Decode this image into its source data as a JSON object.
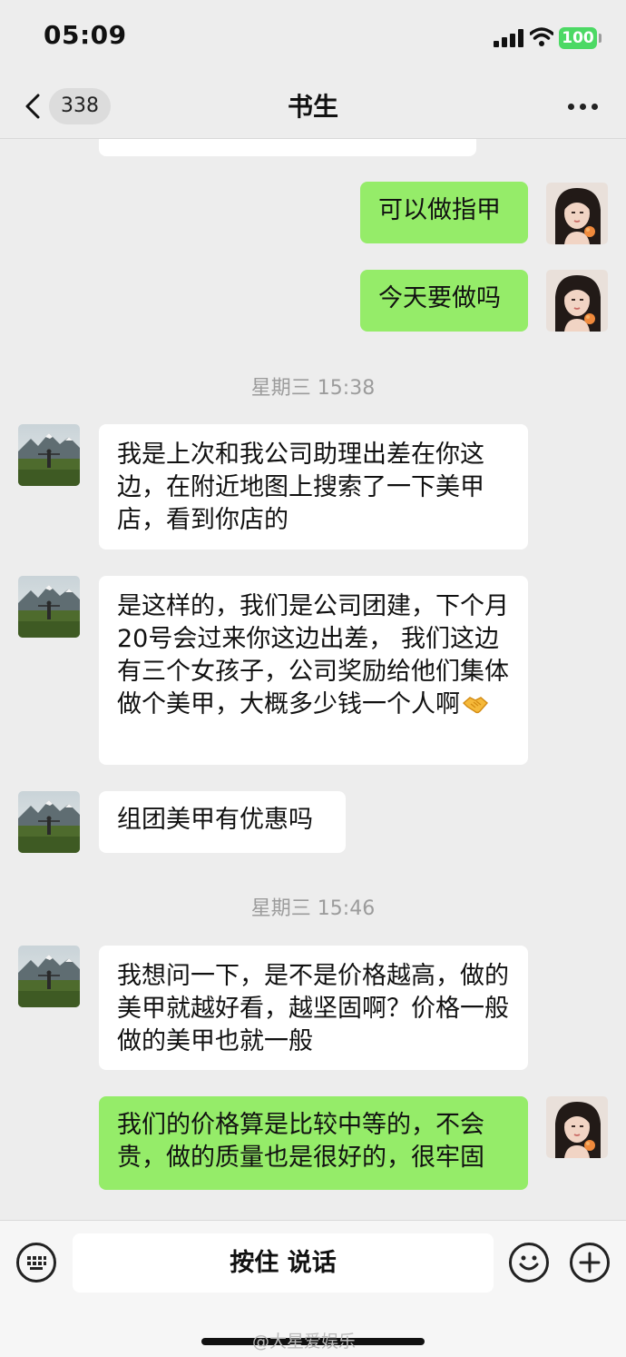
{
  "status_bar": {
    "time": "05:09",
    "battery": "100"
  },
  "nav": {
    "unread_count": "338",
    "title": "书生"
  },
  "messages": [
    {
      "text": "可以做指甲"
    },
    {
      "text": "今天要做吗"
    },
    {
      "time": "星期三 15:38"
    },
    {
      "text": " 我是上次和我公司助理出差在你这边，在附近地图上搜索了一下美甲店，看到你店的"
    },
    {
      "text": "是这样的，我们是公司团建，下个月20号会过来你这边出差， 我们这边有三个女孩子，公司奖励给他们集体做个美甲，大概多少钱一个人啊"
    },
    {
      "text": "组团美甲有优惠吗"
    },
    {
      "time": "星期三 15:46"
    },
    {
      "text": "我想问一下，是不是价格越高，做的美甲就越好看，越坚固啊？价格一般做的美甲也就一般"
    },
    {
      "text": "我们的价格算是比较中等的，不会贵，做的质量也是很好的，很牢固"
    }
  ],
  "input_bar": {
    "voice_label": "按住 说话"
  },
  "watermark": "@大星爱娱乐",
  "colors": {
    "outgoing_bubble": "#95ec69",
    "incoming_bubble": "#ffffff",
    "background": "#ededed"
  }
}
